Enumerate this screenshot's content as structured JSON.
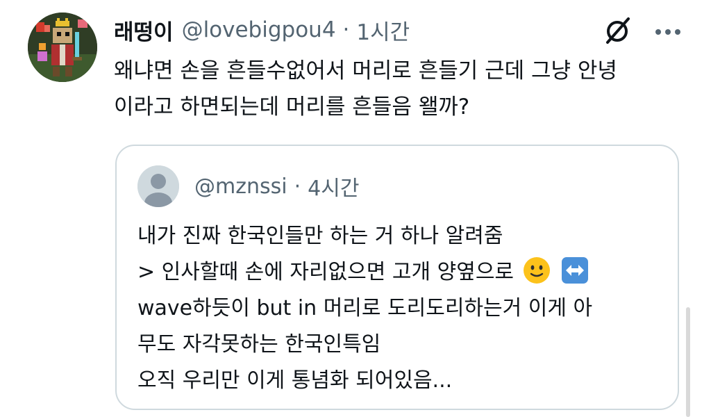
{
  "post": {
    "author_name": "래떵이",
    "handle": "@lovebigpou4",
    "separator": "·",
    "time": "1시간",
    "lines": [
      "왜냐면 손을 흔들수없어서 머리로 흔들기 근데 그냥 안녕",
      "이라고 하면되는데 머리를 흔들음 왤까?"
    ]
  },
  "quote": {
    "handle": "@mznssi",
    "separator": "·",
    "time": "4시간",
    "line1": "내가 진짜 한국인들만 하는 거 하나 알려줌",
    "line2": "> 인사할때 손에 자리없으면 고개 양옆으로",
    "line3": "wave하듯이 but in 머리로 도리도리하는거 이게 아",
    "line4": "무도 자각못하는 한국인특임",
    "line5": "오직 우리만 이게 통념화 되어있음..."
  },
  "icons": {
    "grok": "slashed-circle-icon",
    "more": "more-horizontal-icon",
    "emoji_smile": "slightly-smiling-face",
    "emoji_arrow": "left-right-arrow"
  },
  "colors": {
    "text": "#0f1419",
    "secondary": "#536471",
    "border": "#cfd9de",
    "emoji_yellow": "#fcc21b",
    "arrow_blue": "#4a90d9"
  }
}
